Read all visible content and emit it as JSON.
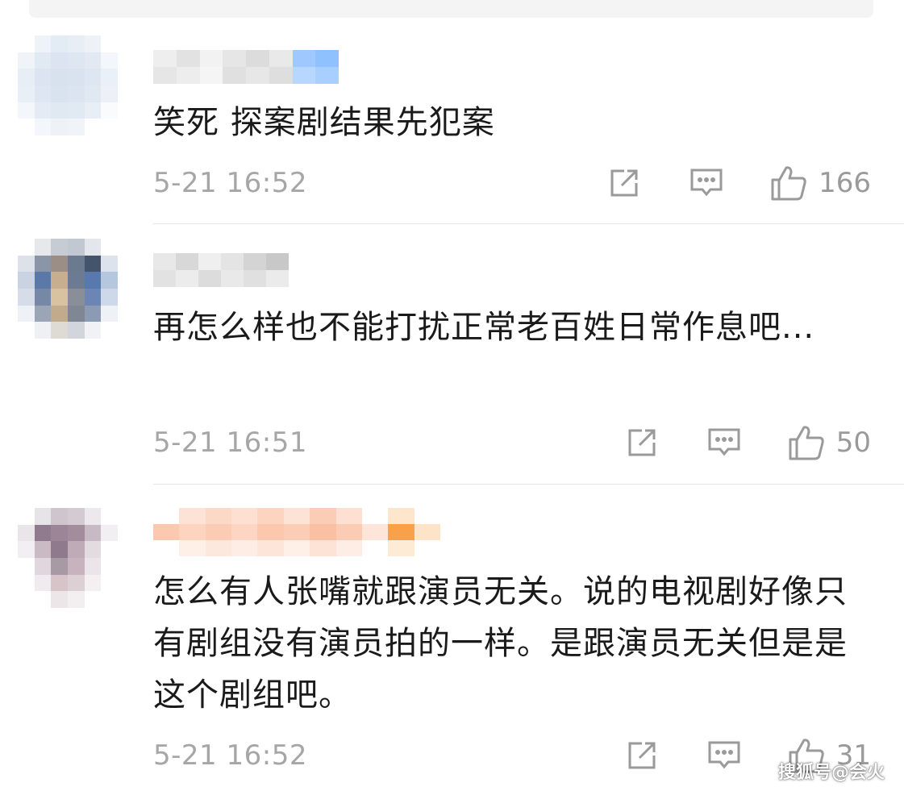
{
  "comments": [
    {
      "text": "笑死 探案剧结果先犯案",
      "time": "5-21 16:52",
      "likes": "166",
      "icons": {
        "share": "share-icon",
        "reply": "comment-icon",
        "like": "thumbs-up-icon"
      }
    },
    {
      "text": "再怎么样也不能打扰正常老百姓日常作息吧...",
      "time": "5-21 16:51",
      "likes": "50",
      "icons": {
        "share": "share-icon",
        "reply": "comment-icon",
        "like": "thumbs-up-icon"
      }
    },
    {
      "text": "怎么有人张嘴就跟演员无关。说的电视剧好像只有剧组没有演员拍的一样。是跟演员无关但是是这个剧组吧。",
      "time": "5-21 16:52",
      "likes": "31",
      "icons": {
        "share": "share-icon",
        "reply": "comment-icon",
        "like": "thumbs-up-icon"
      }
    }
  ],
  "watermark": "搜狐号@会火",
  "colors": {
    "text": "#1a1a1a",
    "meta": "#a6a6a6",
    "divider": "#e6e6e6",
    "icon": "#9a9a9a"
  }
}
